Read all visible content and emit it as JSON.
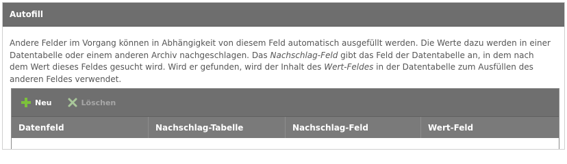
{
  "panel": {
    "title": "Autofill"
  },
  "description": {
    "part1": "Andere Felder im Vorgang können in Abhängigkeit von diesem Feld automatisch ausgefüllt werden. Die Werte dazu werden in einer Datentabelle oder einem anderen Archiv nachgeschlagen. Das ",
    "em1": "Nachschlag-Feld",
    "part2": " gibt das Feld der Datentabelle an, in dem nach dem Wert dieses Feldes gesucht wird. Wird er gefunden, wird der Inhalt des ",
    "em2": "Wert-Feldes",
    "part3": " in der Datentabelle zum Ausfüllen des anderen Feldes verwendet."
  },
  "toolbar": {
    "new_label": "Neu",
    "delete_label": "Löschen",
    "new_icon": "plus-icon",
    "delete_icon": "x-icon",
    "colors": {
      "new": "#7cc13b",
      "delete": "#a9c79a"
    }
  },
  "grid": {
    "columns": [
      "Datenfeld",
      "Nachschlag-Tabelle",
      "Nachschlag-Feld",
      "Wert-Feld"
    ],
    "rows": []
  }
}
